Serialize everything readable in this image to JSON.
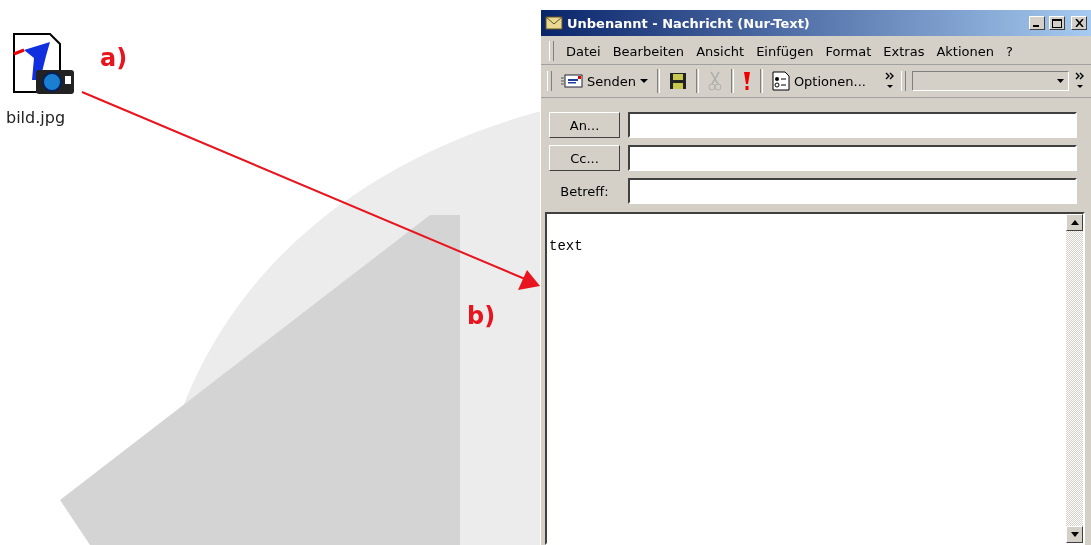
{
  "desktop": {
    "icon": {
      "label": "bild.jpg"
    },
    "annotations": [
      {
        "label": "a)"
      },
      {
        "label": "b)"
      }
    ]
  },
  "window": {
    "title": "Unbenannt - Nachricht (Nur-Text)"
  },
  "menu": [
    "Datei",
    "Bearbeiten",
    "Ansicht",
    "Einfügen",
    "Format",
    "Extras",
    "Aktionen",
    "?"
  ],
  "toolbar": [
    {
      "kind": "send",
      "label": "Senden",
      "disabled": false
    },
    {
      "kind": "save",
      "disabled": false
    },
    {
      "kind": "cut",
      "disabled": true
    },
    {
      "kind": "priority",
      "disabled": false
    },
    {
      "kind": "options",
      "label": "Optionen...",
      "disabled": false
    }
  ],
  "address_fields": [
    {
      "kind": "button",
      "label": "An..."
    },
    {
      "kind": "button",
      "label": "Cc..."
    },
    {
      "kind": "label",
      "label": "Betreff:"
    }
  ],
  "body": {
    "value": "text"
  }
}
